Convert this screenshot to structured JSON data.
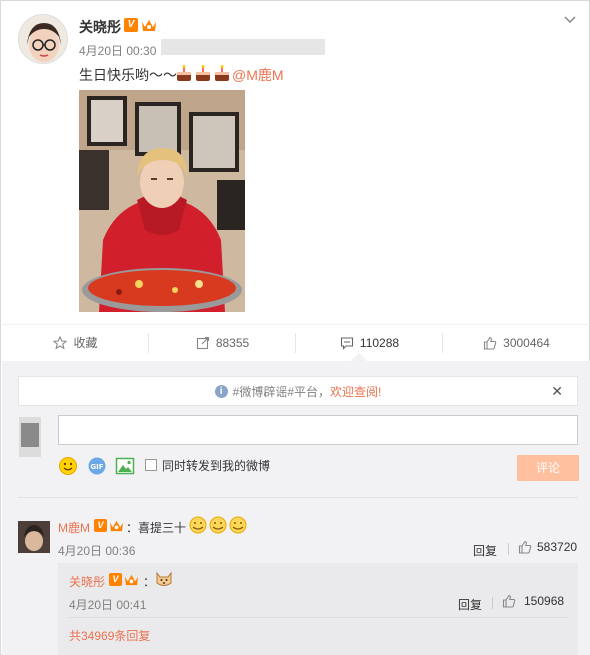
{
  "post": {
    "username": "关晓彤",
    "timestamp": "4月20日 00:30",
    "text": "生日快乐哟～～",
    "mention": "@M鹿M",
    "verified_badge": "V"
  },
  "actions": {
    "favorite_label": "收藏",
    "repost_count": "88355",
    "comment_count": "110288",
    "like_count": "3000464"
  },
  "comment_box": {
    "notice_prefix": "#微博辟谣#平台，",
    "notice_link": "欢迎查阅!",
    "input_value": "",
    "checkbox_label": "同时转发到我的微博",
    "submit_label": "评论"
  },
  "comments": [
    {
      "author": "M鹿M",
      "text": "：喜提三十",
      "time": "4月20日 00:36",
      "reply_label": "回复",
      "likes": "583720",
      "replies": [
        {
          "author": "关晓彤",
          "text": "：",
          "time": "4月20日 00:41",
          "reply_label": "回复",
          "likes": "150968"
        }
      ],
      "total_replies": "共34969条回复"
    }
  ],
  "colors": {
    "accent": "#eb7350",
    "vip_orange": "#ff8200",
    "submit_disabled": "#ffc09f",
    "panel_bg": "#f2f2f5"
  }
}
